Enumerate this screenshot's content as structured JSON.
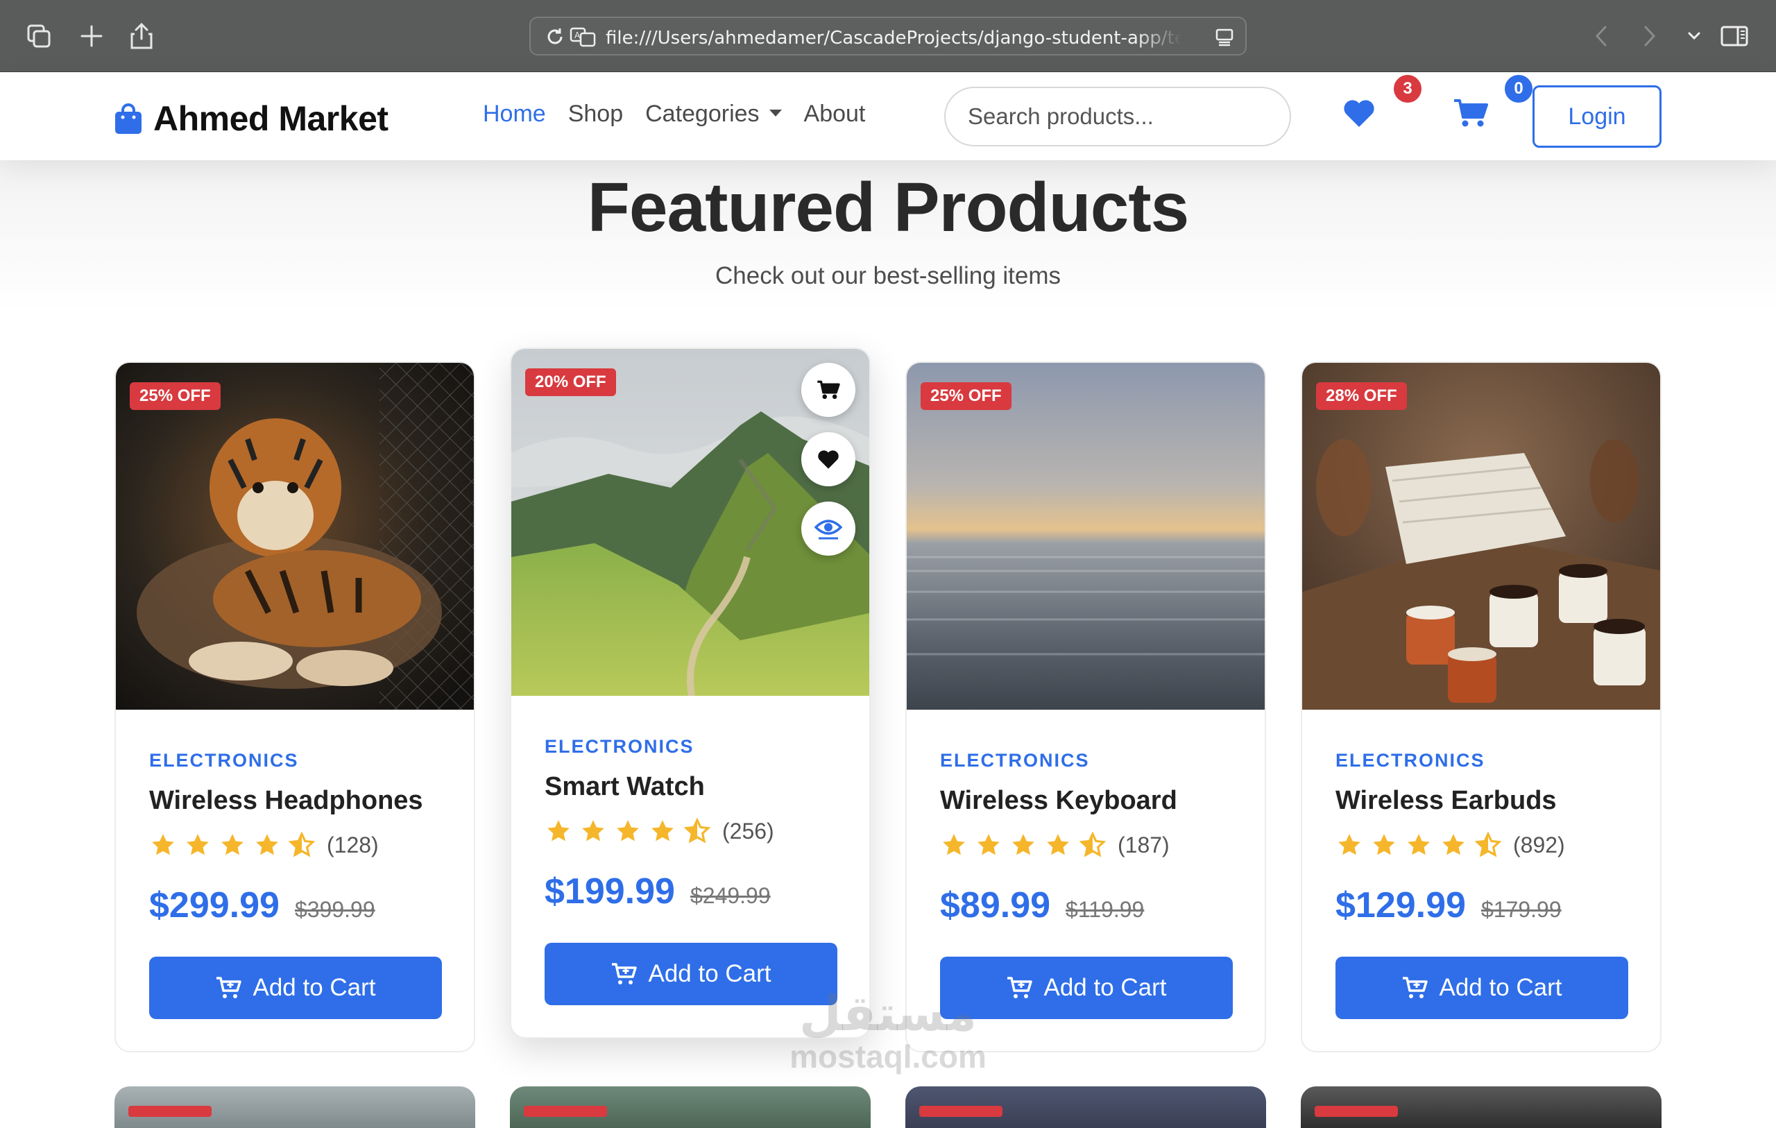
{
  "browser": {
    "url": "file:///Users/ahmedamer/CascadeProjects/django-student-app/templates/index.html"
  },
  "nav": {
    "brand": "Ahmed Market",
    "links": [
      "Home",
      "Shop",
      "Categories",
      "About"
    ],
    "active_link": "Home",
    "search_placeholder": "Search products...",
    "wishlist_count": "3",
    "cart_count": "0",
    "login_label": "Login"
  },
  "section": {
    "title": "Featured Products",
    "subtitle": "Check out our best-selling items"
  },
  "products": [
    {
      "discount": "25% OFF",
      "category": "ELECTRONICS",
      "name": "Wireless Headphones",
      "rating": 4.5,
      "reviews": "(128)",
      "price": "$299.99",
      "old_price": "$399.99",
      "button": "Add to Cart"
    },
    {
      "discount": "20% OFF",
      "category": "ELECTRONICS",
      "name": "Smart Watch",
      "rating": 4.5,
      "reviews": "(256)",
      "price": "$199.99",
      "old_price": "$249.99",
      "button": "Add to Cart"
    },
    {
      "discount": "25% OFF",
      "category": "ELECTRONICS",
      "name": "Wireless Keyboard",
      "rating": 4.5,
      "reviews": "(187)",
      "price": "$89.99",
      "old_price": "$119.99",
      "button": "Add to Cart"
    },
    {
      "discount": "28% OFF",
      "category": "ELECTRONICS",
      "name": "Wireless Earbuds",
      "rating": 4.5,
      "reviews": "(892)",
      "price": "$129.99",
      "old_price": "$179.99",
      "button": "Add to Cart"
    }
  ],
  "watermark": {
    "arabic": "مستقل",
    "latin": "mostaql.com"
  },
  "colors": {
    "accent": "#2f6ee8",
    "discount": "#d83a3f",
    "star": "#f5b62b"
  },
  "icons": [
    "tabs-icon",
    "plus-icon",
    "share-icon",
    "reload-icon",
    "translate-icon",
    "reader-icon",
    "back-icon",
    "forward-icon",
    "sidebar-icon",
    "shopping-bag-icon",
    "heart-icon",
    "cart-icon",
    "cart-plus-icon",
    "eye-icon",
    "star-icon"
  ]
}
